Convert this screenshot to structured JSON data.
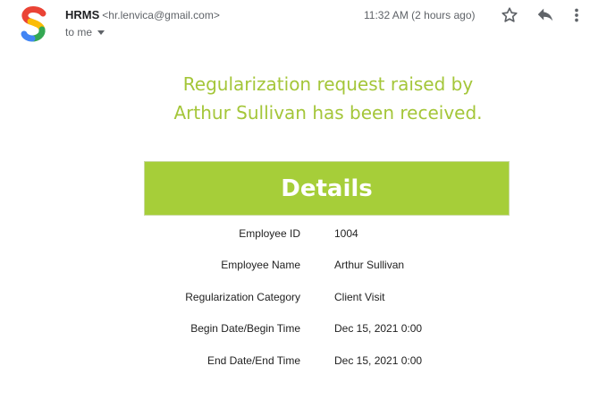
{
  "header": {
    "sender_name": "HRMS",
    "sender_email": "<hr.lenvica@gmail.com>",
    "recipient": "to me",
    "timestamp": "11:32 AM (2 hours ago)",
    "icons": {
      "avatar": "google-s-logo",
      "star": "star-icon",
      "reply": "reply-icon",
      "more": "more-vert-icon"
    }
  },
  "body": {
    "headline_line1": "Regularization request raised by",
    "headline_line2": "Arthur Sullivan has been received.",
    "details_title": "Details",
    "rows": [
      {
        "label": "Employee ID",
        "value": "1004"
      },
      {
        "label": "Employee Name",
        "value": "Arthur Sullivan"
      },
      {
        "label": "Regularization Category",
        "value": "Client Visit"
      },
      {
        "label": "Begin Date/Begin Time",
        "value": "Dec 15, 2021 0:00"
      },
      {
        "label": "End Date/End Time",
        "value": "Dec 15, 2021 0:00"
      }
    ]
  },
  "colors": {
    "accent_green": "#a6ce39",
    "headline_green": "#a4c639",
    "secondary_text": "#5f6368"
  }
}
